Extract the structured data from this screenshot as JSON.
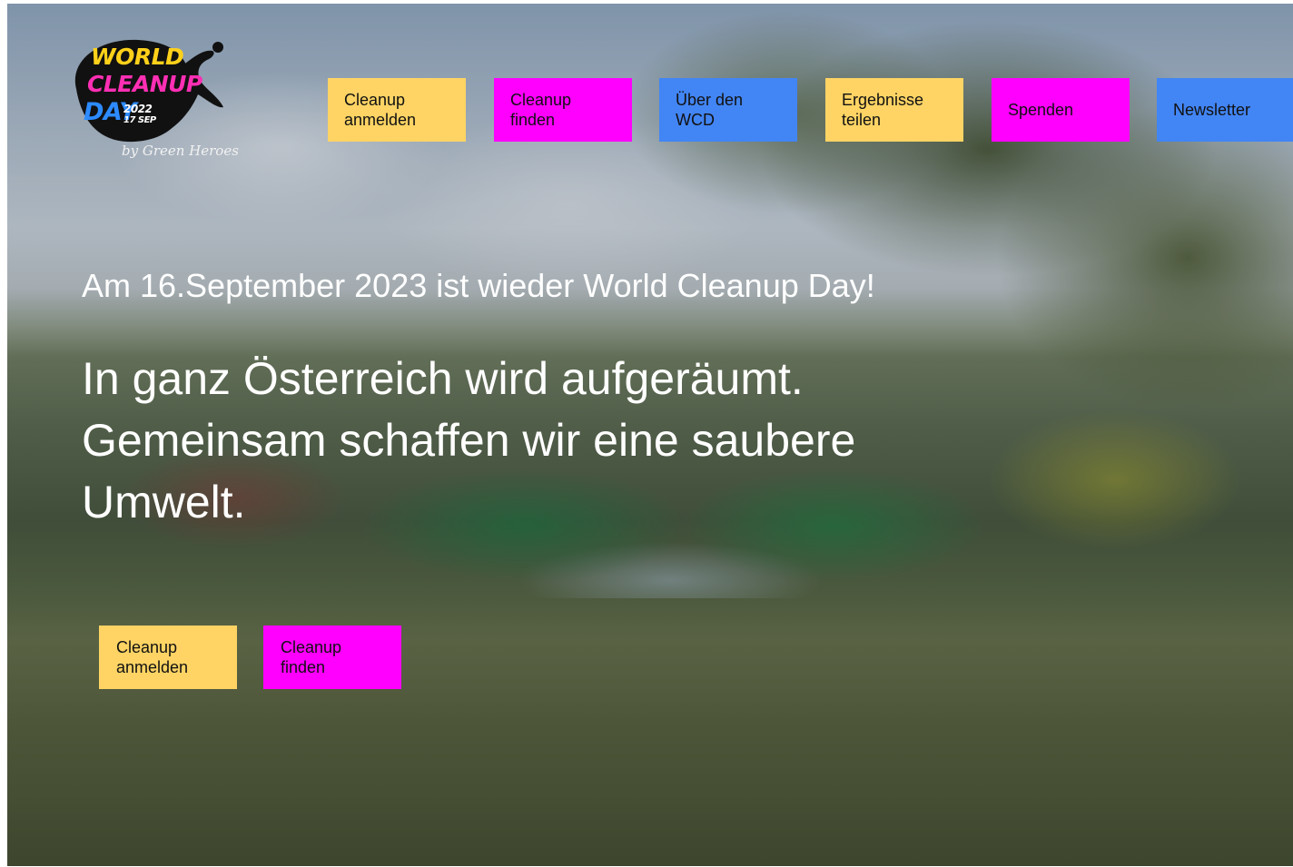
{
  "logo": {
    "line1": "WORLD",
    "line2": "CLEANUP",
    "line3": "DAY",
    "year": "2022",
    "date": "17 SEP",
    "byline": "by Green Heroes"
  },
  "nav": {
    "items": [
      {
        "label": "Cleanup anmelden"
      },
      {
        "label": "Cleanup finden"
      },
      {
        "label": "Über den WCD"
      },
      {
        "label": "Ergebnisse teilen"
      },
      {
        "label": "Spenden"
      },
      {
        "label": "Newsletter"
      }
    ]
  },
  "hero": {
    "subtitle": "Am 16.September 2023 ist wieder World Cleanup Day!",
    "headline": "In ganz Österreich wird aufgeräumt. Gemeinsam schaffen wir eine saubere Umwelt."
  },
  "cta": {
    "items": [
      {
        "label": "Cleanup anmelden"
      },
      {
        "label": "Cleanup finden"
      }
    ]
  },
  "colors": {
    "yellow": "#ffd464",
    "magenta": "#ff00ff",
    "blue": "#4285f4",
    "logo_yellow": "#ffd11a",
    "logo_pink": "#ff2fb4",
    "logo_blue": "#2d8bff"
  }
}
